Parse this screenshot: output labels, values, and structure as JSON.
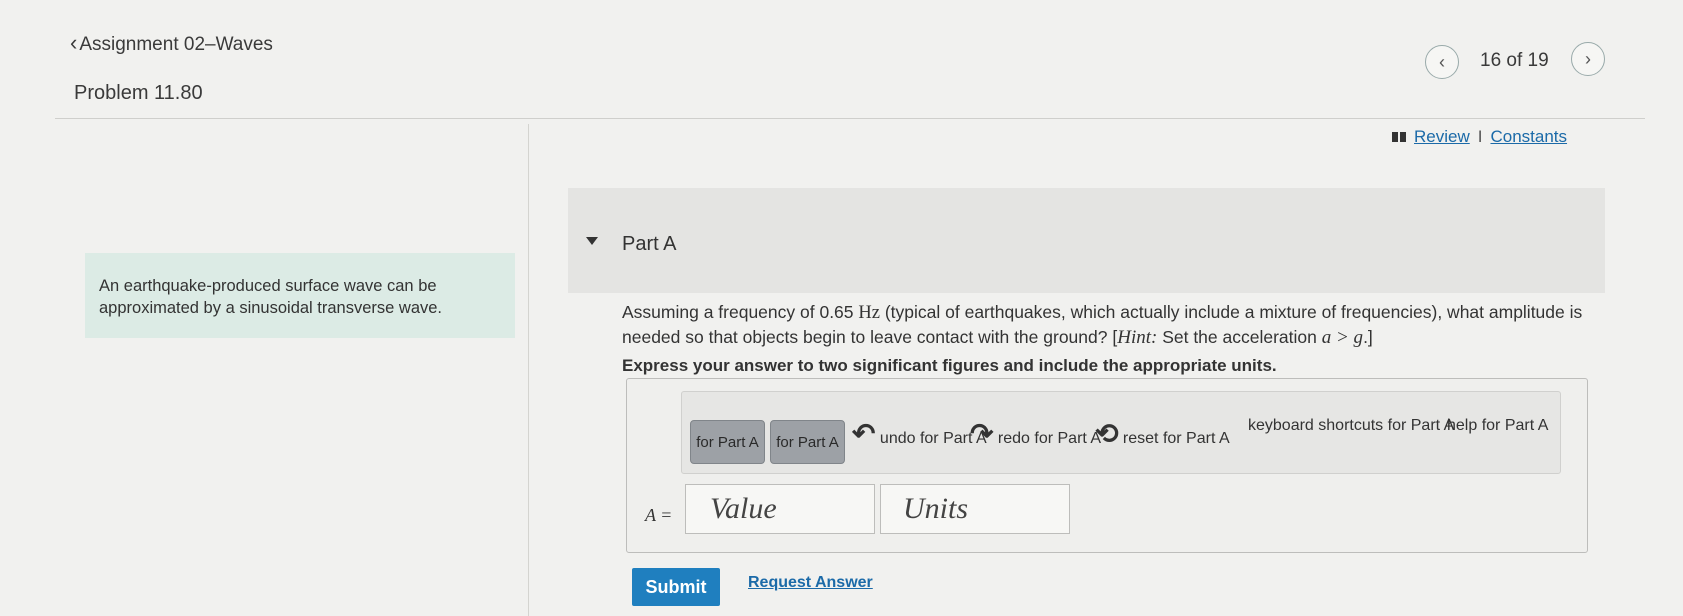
{
  "header": {
    "back_label": "Assignment 02–Waves",
    "problem_title": "Problem 11.80",
    "pager_count": "16 of 19"
  },
  "links": {
    "review": "Review",
    "separator": "I",
    "constants": "Constants"
  },
  "intro": {
    "text": "An earthquake-produced surface wave can be approximated by a sinusoidal transverse wave."
  },
  "part": {
    "title": "Part A",
    "question_pre": "Assuming a frequency of 0.65 ",
    "question_unit": "Hz",
    "question_mid": " (typical of earthquakes, which actually include a mixture of frequencies), what amplitude is needed so that objects begin to leave contact with the ground? [",
    "hint_label": "Hint:",
    "hint_text": " Set the acceleration ",
    "hint_math": "a > g",
    "hint_end": ".]",
    "instruction": "Express your answer to two significant figures and include the appropriate units."
  },
  "toolbar": {
    "btn1_label": "for Part A",
    "btn2_label": "for Part A",
    "undo_label": "undo for Part A",
    "redo_label": "redo for Part A",
    "reset_label": "reset for Part A",
    "shortcuts_label": "keyboard shortcuts for Part A",
    "help_label": "help for Part A"
  },
  "answer": {
    "variable": "A =",
    "value_placeholder": "Value",
    "units_placeholder": "Units"
  },
  "actions": {
    "submit": "Submit",
    "request_answer": "Request Answer"
  }
}
